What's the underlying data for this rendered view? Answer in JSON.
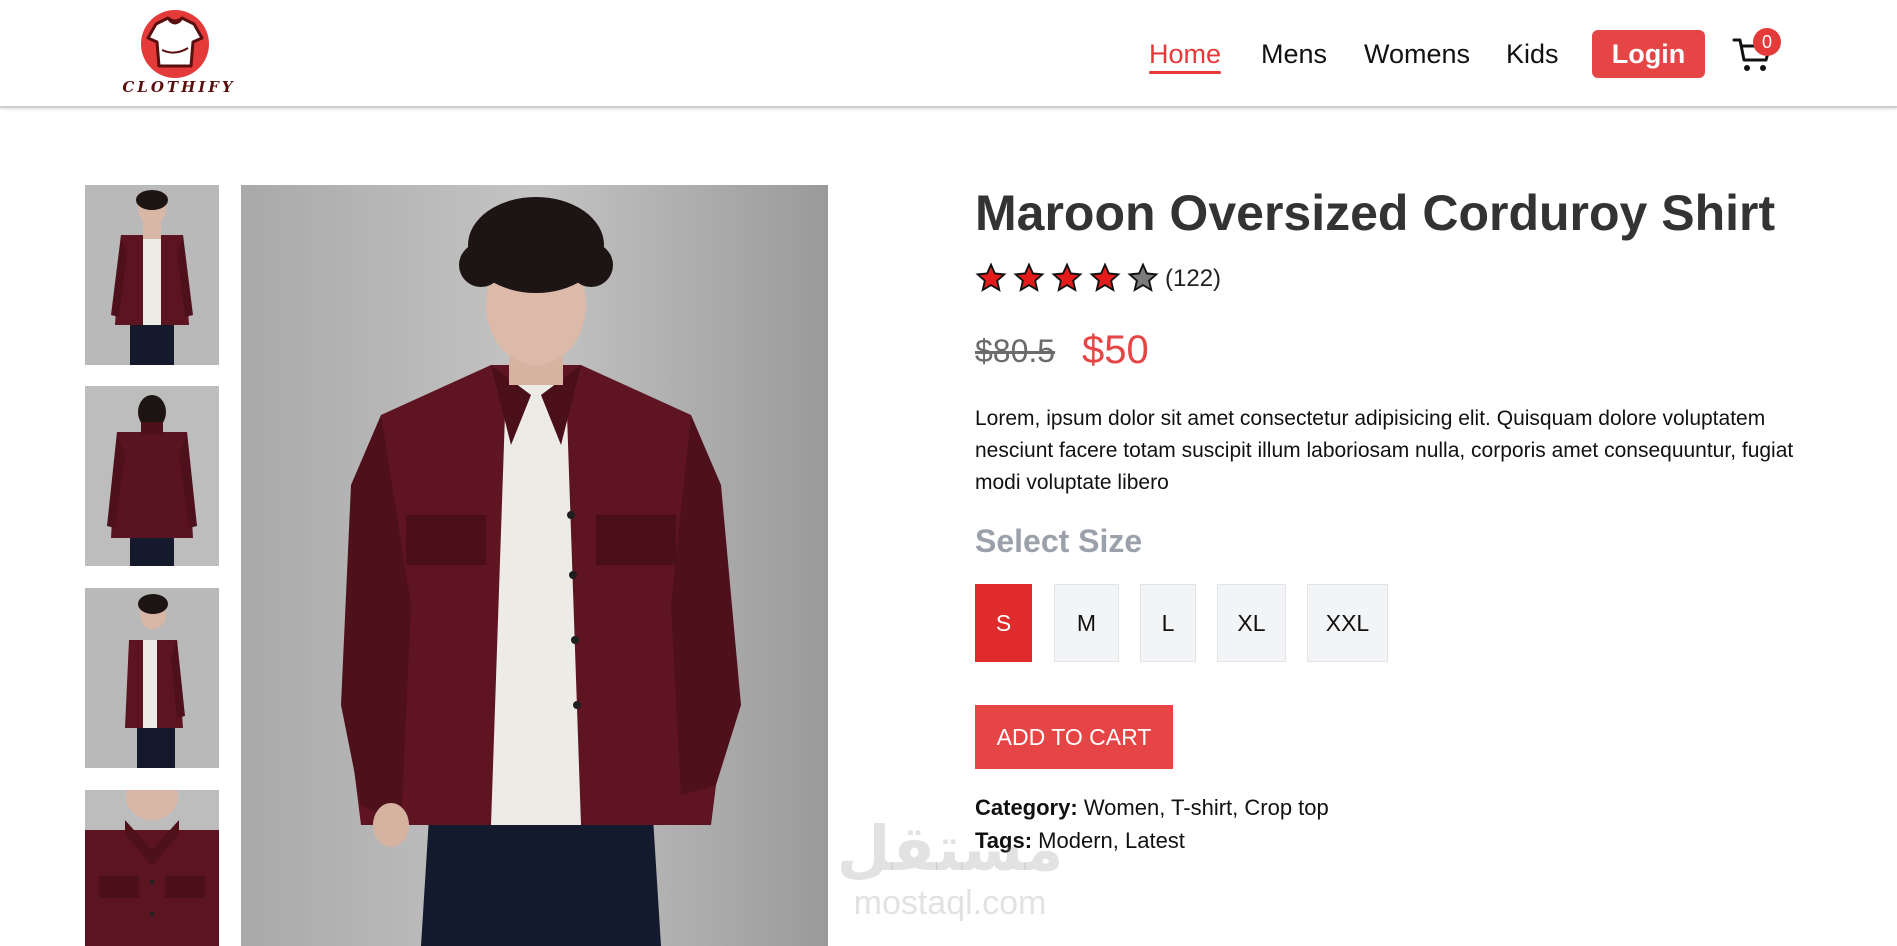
{
  "brand": {
    "name": "CLOTHIFY",
    "accent": "#e64545"
  },
  "nav": {
    "items": [
      {
        "label": "Home",
        "active": true
      },
      {
        "label": "Mens",
        "active": false
      },
      {
        "label": "Womens",
        "active": false
      },
      {
        "label": "Kids",
        "active": false
      }
    ],
    "login_label": "Login",
    "cart_icon": "cart-icon",
    "cart_count": "0"
  },
  "gallery": {
    "thumbnails": [
      "front view",
      "back view",
      "side view",
      "detail view"
    ],
    "selected": 0
  },
  "product": {
    "title": "Maroon Oversized Corduroy Shirt",
    "rating": 4,
    "rating_max": 5,
    "rating_count": "(122)",
    "old_price": "$80.5",
    "new_price": "$50",
    "description": "Lorem, ipsum dolor sit amet consectetur adipisicing elit. Quisquam dolore voluptatem nesciunt facere totam suscipit illum laboriosam nulla, corporis amet consequuntur, fugiat modi voluptate libero",
    "size_label": "Select Size",
    "sizes": [
      "S",
      "M",
      "L",
      "XL",
      "XXL"
    ],
    "selected_size": "S",
    "add_to_cart_label": "ADD TO CART",
    "category_label": "Category:",
    "category_value": "Women, T-shirt, Crop top",
    "tags_label": "Tags:",
    "tags_value": "Modern, Latest"
  },
  "watermark": {
    "arabic": "مستقل",
    "latin": "mostaql.com"
  }
}
